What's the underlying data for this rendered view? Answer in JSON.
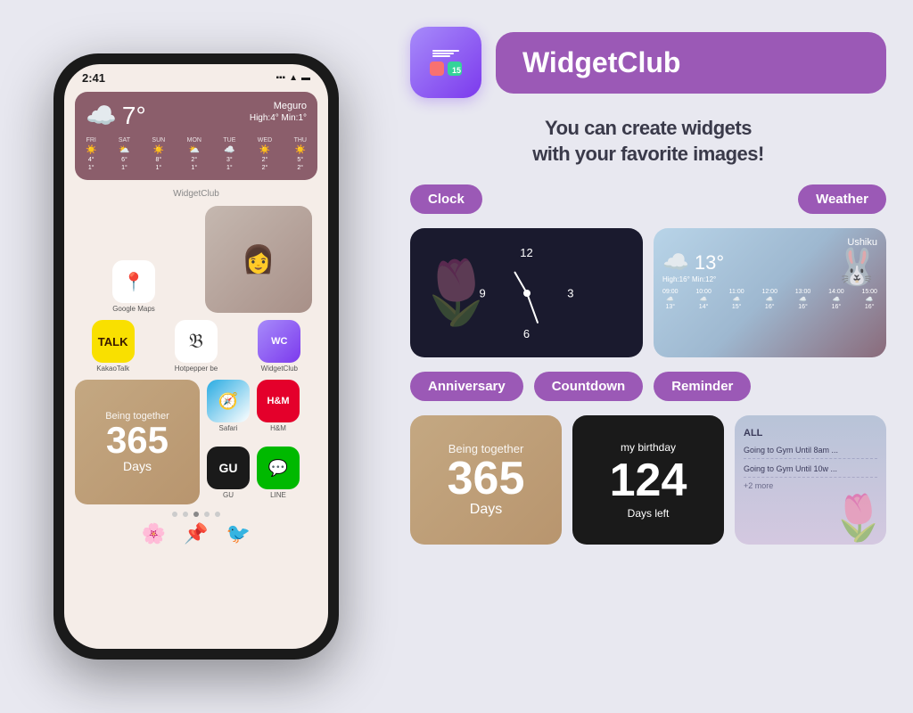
{
  "page": {
    "background_color": "#e8e8f0"
  },
  "phone": {
    "time": "2:41",
    "status": "●●● ▲ ⬛",
    "weather": {
      "temperature": "7°",
      "location": "Meguro",
      "high": "High:4°",
      "min": "Min:1°",
      "days": [
        {
          "name": "FRI",
          "icon": "☀️",
          "high": "4°",
          "low": "1°"
        },
        {
          "name": "SAT",
          "icon": "⛅",
          "high": "6°",
          "low": "1°"
        },
        {
          "name": "SUN",
          "icon": "☀️",
          "high": "8°",
          "low": "1°"
        },
        {
          "name": "MON",
          "icon": "⛅",
          "high": "2°",
          "low": "1°"
        },
        {
          "name": "TUE",
          "icon": "☁️",
          "high": "3°",
          "low": "1°"
        },
        {
          "name": "WED",
          "icon": "☀️",
          "high": "2°",
          "low": "2°"
        },
        {
          "name": "THU",
          "icon": "☀️",
          "high": "5°",
          "low": "2°"
        }
      ]
    },
    "widgetclub_label": "WidgetClub",
    "app_icons": [
      {
        "name": "Google Maps",
        "emoji": "📍",
        "color": "#fff"
      },
      {
        "name": "KakaoTalk",
        "emoji": "💬",
        "color": "#f9e000"
      },
      {
        "name": "Hotpepper be",
        "emoji": "𝔅",
        "color": "#fff"
      },
      {
        "name": "WidgetClub",
        "emoji": "🖼️",
        "color": "#fff"
      },
      {
        "name": "Safari",
        "emoji": "🧭",
        "color": "#fff"
      },
      {
        "name": "H&M",
        "emoji": "H&M",
        "color": "#e4002b"
      },
      {
        "name": "GU",
        "emoji": "GU",
        "color": "#1a1a1a"
      },
      {
        "name": "LINE",
        "emoji": "💬",
        "color": "#00b900"
      }
    ],
    "anniversary": {
      "being_together": "Being together",
      "number": "365",
      "days": "Days"
    },
    "page_dots": [
      false,
      false,
      true,
      false,
      false
    ]
  },
  "right": {
    "app": {
      "name": "WidgetClub",
      "icon_number": "15"
    },
    "tagline_line1": "You can create widgets",
    "tagline_line2": "with your favorite images!",
    "categories": [
      {
        "label": "Clock",
        "id": "clock"
      },
      {
        "label": "Weather",
        "id": "weather"
      }
    ],
    "bottom_categories": [
      {
        "label": "Anniversary",
        "id": "anniversary"
      },
      {
        "label": "Countdown",
        "id": "countdown"
      },
      {
        "label": "Reminder",
        "id": "reminder"
      }
    ],
    "clock_widget": {
      "numbers": [
        "12",
        "3",
        "6",
        "9"
      ]
    },
    "weather_widget": {
      "location": "Ushiku",
      "temperature": "13°",
      "high": "High:16°",
      "min": "Min:12°",
      "cloud": "☁️",
      "hours": [
        "09:00",
        "10:00",
        "11:00",
        "12:00",
        "13:00",
        "14:00",
        "15:00"
      ],
      "hour_temps": [
        "13°",
        "14°",
        "15°",
        "16°",
        "16°",
        "16°",
        "16°"
      ]
    },
    "anniversary_widget": {
      "being_together": "Being together",
      "number": "365",
      "days": "Days"
    },
    "countdown_widget": {
      "label": "my birthday",
      "number": "124",
      "sublabel": "Days left"
    },
    "reminder_widget": {
      "all_label": "ALL",
      "items": [
        "Going to Gym Until 8am ...",
        "Going to Gym Until 10w ..."
      ],
      "more": "+2 more"
    }
  }
}
